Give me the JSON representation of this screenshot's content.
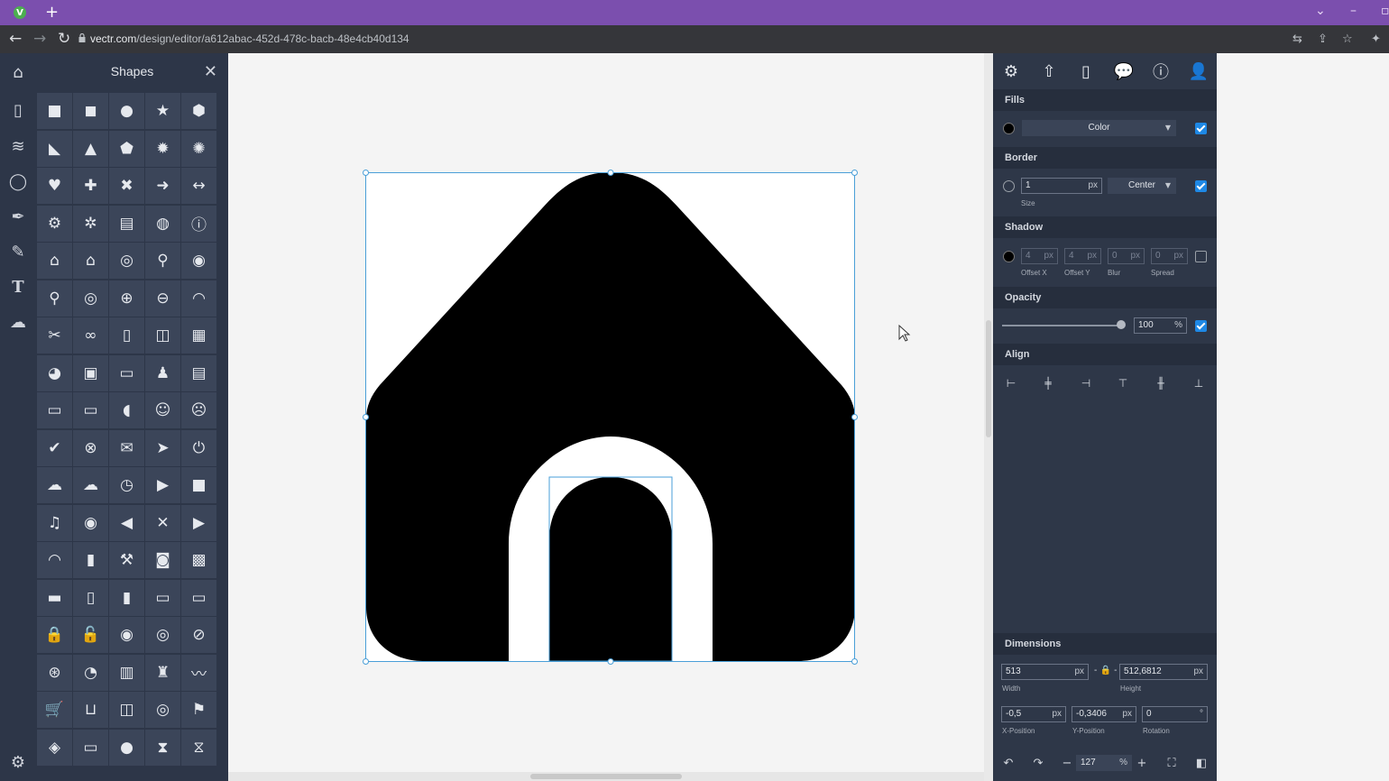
{
  "browser": {
    "favicon_letter": "V",
    "new_tab": "+",
    "url_host": "vectr.com",
    "url_path": "/design/editor/a612abac-452d-478c-bacb-48e4cb40d134"
  },
  "shapes_panel": {
    "title": "Shapes",
    "close": "✕"
  },
  "props": {
    "fills": {
      "header": "Fills",
      "mode": "Color",
      "enabled": true,
      "color": "#000000"
    },
    "border": {
      "header": "Border",
      "size": "1",
      "unit": "px",
      "size_label": "Size",
      "position": "Center",
      "enabled": true
    },
    "shadow": {
      "header": "Shadow",
      "offset_x": "4",
      "offset_y": "4",
      "blur": "0",
      "spread": "0",
      "unit": "px",
      "offset_x_label": "Offset X",
      "offset_y_label": "Offset Y",
      "blur_label": "Blur",
      "spread_label": "Spread",
      "enabled": false
    },
    "opacity": {
      "header": "Opacity",
      "value": "100",
      "unit": "%",
      "enabled": true,
      "level_percent": 100
    },
    "align": {
      "header": "Align"
    },
    "dimensions": {
      "header": "Dimensions",
      "width": "513",
      "height": "512,6812",
      "unit": "px",
      "width_label": "Width",
      "height_label": "Height",
      "x": "-0,5",
      "y": "-0,3406",
      "rotation": "0",
      "rotation_unit": "°",
      "x_label": "X-Position",
      "y_label": "Y-Position",
      "rotation_label": "Rotation",
      "lock_dash": "-"
    },
    "zoom": {
      "value": "127",
      "unit": "%",
      "minus": "−",
      "plus": "+"
    }
  },
  "colors": {
    "accent": "#1e88e5",
    "panel": "#2e3748",
    "tab_bar": "#7b4fae"
  }
}
